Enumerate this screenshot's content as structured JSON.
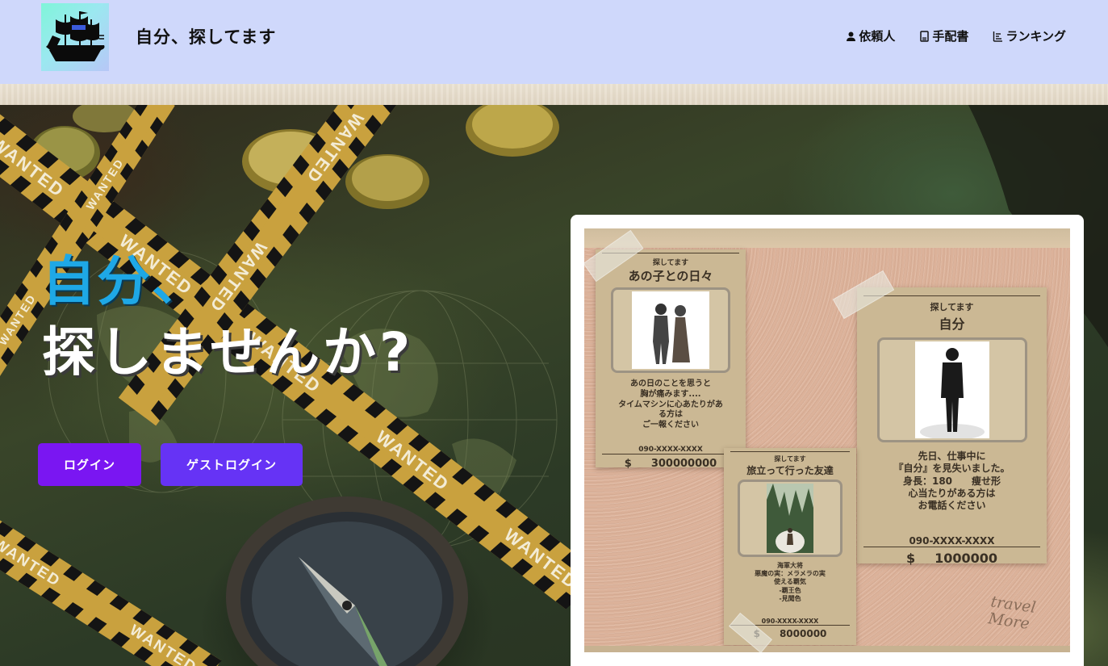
{
  "header": {
    "site_title": "自分、探してます",
    "logo_icon": "pirate-ship-icon",
    "nav": [
      {
        "label": "依頼人",
        "icon": "person-icon"
      },
      {
        "label": "手配書",
        "icon": "document-icon"
      },
      {
        "label": "ランキング",
        "icon": "ranking-list-icon"
      }
    ]
  },
  "hero": {
    "line1": "自分、",
    "line2": "探しませんか?",
    "login_label": "ログイン",
    "guest_login_label": "ゲストログイン",
    "tape_text": "WANTED"
  },
  "board": {
    "posters": [
      {
        "header": "探してます",
        "title": "あの子との日々",
        "desc": [
          "あの日のことを思うと",
          "胸が痛みます....",
          "タイムマシンに心あたりがあ",
          "る方は",
          "ご一報ください"
        ],
        "phone": "090-XXXX-XXXX",
        "currency": "$",
        "reward": "300000000"
      },
      {
        "header": "探してます",
        "title": "自分",
        "desc": [
          "先日、仕事中に",
          "『自分』を見失いました。",
          "身長：180　　痩せ形",
          "心当たりがある方は",
          "お電話ください"
        ],
        "phone": "090-XXXX-XXXX",
        "currency": "$",
        "reward": "1000000"
      },
      {
        "header": "探してます",
        "title": "旅立って行った友達",
        "desc": [
          "海軍大将",
          "悪魔の実：メラメラの実",
          "使える覇気",
          "-覇王色",
          "-見聞色"
        ],
        "phone": "090-XXXX-XXXX",
        "currency": "$",
        "reward": "8000000"
      }
    ],
    "corner_text": [
      "travel",
      "More"
    ]
  },
  "colors": {
    "header_bg": "#cfd8fb",
    "hero_accent": "#1ea8e6",
    "login_button": "#7a16f2",
    "guest_button": "#6633f5"
  }
}
